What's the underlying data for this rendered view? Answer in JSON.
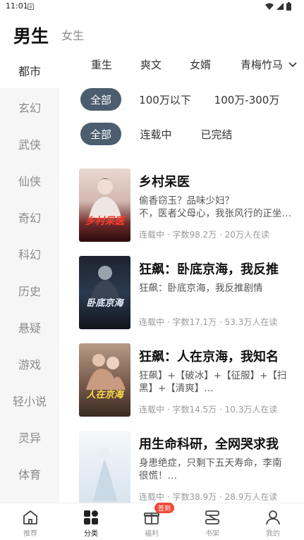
{
  "status": {
    "time": "11:01"
  },
  "header": {
    "male": "男生",
    "female": "女生"
  },
  "sidebar": {
    "items": [
      {
        "label": "都市"
      },
      {
        "label": "玄幻"
      },
      {
        "label": "武侠"
      },
      {
        "label": "仙侠"
      },
      {
        "label": "奇幻"
      },
      {
        "label": "科幻"
      },
      {
        "label": "历史"
      },
      {
        "label": "悬疑"
      },
      {
        "label": "游戏"
      },
      {
        "label": "轻小说"
      },
      {
        "label": "灵异"
      },
      {
        "label": "体育"
      }
    ]
  },
  "subcats": {
    "items": [
      "重生",
      "爽文",
      "女婿",
      "青梅竹马"
    ]
  },
  "filters": {
    "words": [
      "全部",
      "100万以下",
      "100万-300万"
    ],
    "status": [
      "全部",
      "连载中",
      "已完结"
    ]
  },
  "books": [
    {
      "title": "乡村呆医",
      "desc1": "偷香窃玉？品味少妇？",
      "desc2": "不，医者父母心，我张风行的正坐…",
      "meta": "连载中 · 字数98.2万 · 20万人在读",
      "cover_text": "乡村呆医"
    },
    {
      "title": "狂飙：卧底京海，我反推",
      "desc1": "狂飙：卧底京海，我反推剧情",
      "desc2": "",
      "meta": "连载中 · 字数17.1万 · 53.3万人在读",
      "cover_text": "卧底京海"
    },
    {
      "title": "狂飙：人在京海，我知名",
      "desc1": "狂飙】+【破冰】+【征服】+【扫",
      "desc2": "黑】+【清爽】…",
      "meta": "连载中 · 字数14.5万 · 10.3万人在读",
      "cover_text": "人在京海"
    },
    {
      "title": "用生命科研，全网哭求我",
      "desc1": "身患绝症，只剩下五天寿命，李南",
      "desc2": "很慌！…",
      "meta": "连载中 · 字数38.9万 · 28.9万人在读",
      "cover_text": ""
    }
  ],
  "nav": {
    "items": [
      {
        "label": "推荐"
      },
      {
        "label": "分类"
      },
      {
        "label": "福利"
      },
      {
        "label": "书架"
      },
      {
        "label": "我的"
      }
    ],
    "badge": "签到"
  },
  "colors": {
    "chip_active": "#4b5d6e",
    "badge": "#ef4a3a"
  }
}
